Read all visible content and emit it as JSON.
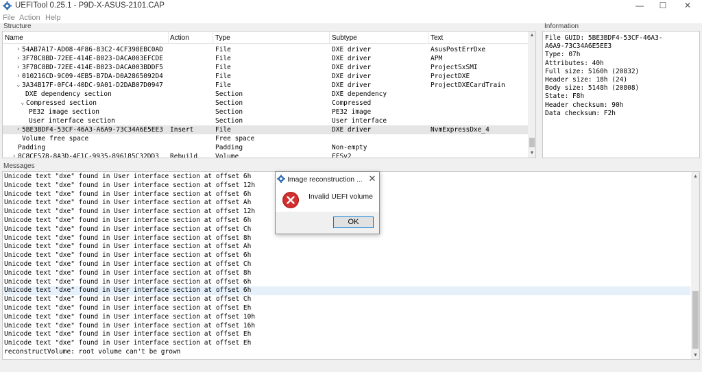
{
  "window": {
    "title": "UEFITool 0.25.1 - P9D-X-ASUS-2101.CAP",
    "controls": {
      "minimize": "—",
      "maximize": "☐",
      "close": "✕"
    }
  },
  "menu": [
    "File",
    "Action",
    "Help"
  ],
  "structure": {
    "label": "Structure",
    "columns": [
      "Name",
      "Action",
      "Type",
      "Subtype",
      "Text"
    ],
    "rows": [
      {
        "arrow": "›",
        "name": "54AB7A17-AD08-4F86-83C2-4CF398EBC0AD",
        "action": "",
        "type": "File",
        "subtype": "DXE driver",
        "text": "AsusPostErrDxe"
      },
      {
        "arrow": "›",
        "name": "3F78C8BD-72EE-414E-B023-DACA003EFCDE",
        "action": "",
        "type": "File",
        "subtype": "DXE driver",
        "text": "APM"
      },
      {
        "arrow": "›",
        "name": "3F78C8BD-72EE-414E-B023-DACA003BDDF5",
        "action": "",
        "type": "File",
        "subtype": "DXE driver",
        "text": "ProjectSxSMI"
      },
      {
        "arrow": "›",
        "name": "010216CD-9C09-4EB5-B7DA-D0A2865092D4",
        "action": "",
        "type": "File",
        "subtype": "DXE driver",
        "text": "ProjectDXE"
      },
      {
        "arrow": "⌄",
        "name": "3A34B17F-0FC4-40DC-9A01-D2DAB07D0947",
        "action": "",
        "type": "File",
        "subtype": "DXE driver",
        "text": "ProjectDXECardTrain"
      },
      {
        "arrow": "",
        "name": "DXE dependency section",
        "action": "",
        "type": "Section",
        "subtype": "DXE dependency",
        "text": ""
      },
      {
        "arrow": "⌄",
        "name": "Compressed section",
        "action": "",
        "type": "Section",
        "subtype": "Compressed",
        "text": ""
      },
      {
        "arrow": "",
        "name": "PE32 image section",
        "action": "",
        "type": "Section",
        "subtype": "PE32 image",
        "text": ""
      },
      {
        "arrow": "",
        "name": "User interface section",
        "action": "",
        "type": "Section",
        "subtype": "User interface",
        "text": ""
      },
      {
        "arrow": "›",
        "name": "5BE3BDF4-53CF-46A3-A6A9-73C34A6E5EE3",
        "action": "Insert",
        "type": "File",
        "subtype": "DXE driver",
        "text": "NvmExpressDxe_4"
      },
      {
        "arrow": "",
        "name": "Volume free space",
        "action": "",
        "type": "Free space",
        "subtype": "",
        "text": ""
      },
      {
        "arrow": "",
        "name": "Padding",
        "action": "",
        "type": "Padding",
        "subtype": "Non-empty",
        "text": ""
      },
      {
        "arrow": "›",
        "name": "8C8CE578-8A3D-4F1C-9935-896185C32DD3",
        "action": "Rebuild",
        "type": "Volume",
        "subtype": "FFSv2",
        "text": ""
      }
    ]
  },
  "information": {
    "label": "Information",
    "lines": [
      "File GUID: 5BE3BDF4-53CF-46A3-",
      "A6A9-73C34A6E5EE3",
      "Type: 07h",
      "Attributes: 40h",
      "Full size: 5160h (20832)",
      "Header size: 18h (24)",
      "Body size: 5148h (20808)",
      "State: F8h",
      "Header checksum: 90h",
      "Data checksum: F2h"
    ]
  },
  "messages": {
    "label": "Messages",
    "lines": [
      "Unicode text \"dxe\" found in User interface section at offset 6h",
      "Unicode text \"dxe\" found in User interface section at offset 12h",
      "Unicode text \"dxe\" found in User interface section at offset 6h",
      "Unicode text \"dxe\" found in User interface section at offset Ah",
      "Unicode text \"dxe\" found in User interface section at offset 12h",
      "Unicode text \"dxe\" found in User interface section at offset 6h",
      "Unicode text \"dxe\" found in User interface section at offset Ch",
      "Unicode text \"dxe\" found in User interface section at offset 8h",
      "Unicode text \"dxe\" found in User interface section at offset Ah",
      "Unicode text \"dxe\" found in User interface section at offset 6h",
      "Unicode text \"dxe\" found in User interface section at offset Ch",
      "Unicode text \"dxe\" found in User interface section at offset 8h",
      "Unicode text \"dxe\" found in User interface section at offset 6h",
      "Unicode text \"dxe\" found in User interface section at offset 6h",
      "Unicode text \"dxe\" found in User interface section at offset Ch",
      "Unicode text \"dxe\" found in User interface section at offset Eh",
      "Unicode text \"dxe\" found in User interface section at offset 10h",
      "Unicode text \"dxe\" found in User interface section at offset 16h",
      "Unicode text \"dxe\" found in User interface section at offset Eh",
      "Unicode text \"dxe\" found in User interface section at offset Eh",
      "reconstructVolume: root volume can't be grown"
    ]
  },
  "dialog": {
    "title": "Image reconstruction ...",
    "close": "✕",
    "message": "Invalid UEFI volume",
    "ok_label": "OK",
    "icon": "error-icon"
  },
  "colors": {
    "selection": "#e5e5e5",
    "message_highlight": "#e6f0fa",
    "error_red": "#d32f2f",
    "focus_blue": "#0078d7"
  }
}
